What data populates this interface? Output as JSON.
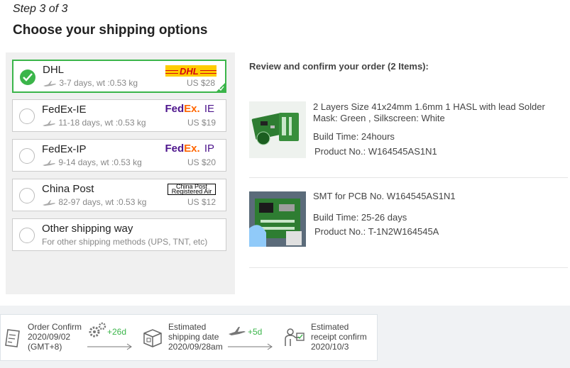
{
  "step": "Step 3 of 3",
  "heading": "Choose your shipping options",
  "options": [
    {
      "name": "DHL",
      "desc": "3-7 days, wt :0.53 kg",
      "price": "US $28",
      "logo": "DHL",
      "selected": true
    },
    {
      "name": "FedEx-IE",
      "desc": "11-18 days, wt :0.53 kg",
      "price": "US $19",
      "logo_suffix": "IE"
    },
    {
      "name": "FedEx-IP",
      "desc": "9-14 days, wt :0.53 kg",
      "price": "US $20",
      "logo_suffix": "IP"
    },
    {
      "name": "China Post",
      "desc": "82-97 days, wt :0.53 kg",
      "price": "US $12",
      "logo_line1": "China Post",
      "logo_line2": "Registered Air"
    },
    {
      "name": "Other shipping way",
      "desc": "For other shipping methods (UPS, TNT, etc)"
    }
  ],
  "fedex_logo": {
    "fed": "Fed",
    "ex": "Ex",
    "suffix_dot": "."
  },
  "review_title": "Review and confirm your order (2 Items):",
  "items": [
    {
      "desc": "2 Layers Size 41x24mm 1.6mm 1 HASL with lead Solder Mask: Green , Silkscreen: White",
      "build_time": "Build Time: 24hours",
      "product_no": "Product No.: W164545AS1N1"
    },
    {
      "desc": "SMT for PCB No. W164545AS1N1",
      "build_time": "Build Time: 25-26 days",
      "product_no": "Product No.: T-1N2W164545A"
    }
  ],
  "timeline": {
    "order_confirm": {
      "line1": "Order Confirm",
      "line2": "2020/09/02",
      "line3": "(GMT+8)"
    },
    "build_days": "+26d",
    "shipping": {
      "line1": "Estimated",
      "line2": "shipping date",
      "line3": "2020/09/28am"
    },
    "ship_days": "+5d",
    "receipt": {
      "line1": "Estimated",
      "line2": "receipt confirm",
      "line3": "2020/10/3"
    }
  },
  "colors": {
    "accent_green": "#3bb54a",
    "dhl_yellow": "#ffcc00",
    "dhl_red": "#d40511",
    "fedex_purple": "#4d148c",
    "fedex_orange": "#ff6600"
  }
}
